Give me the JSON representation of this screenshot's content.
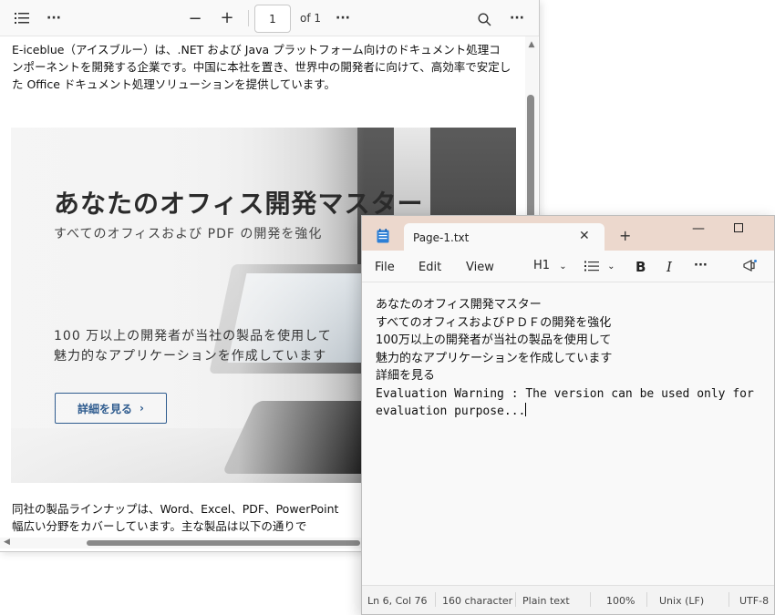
{
  "pdf_viewer": {
    "toolbar": {
      "page_number": "1",
      "page_total": "of 1"
    },
    "intro_text": "E-iceblue（アイスブルー）は、.NET および Java プラットフォーム向けのドキュメント処理コンポーネントを開発する企業です。中国に本社を置き、世界中の開発者に向けて、高効率で安定した Office ドキュメント処理ソリューションを提供しています。",
    "banner": {
      "title": "あなたのオフィス開発マスター",
      "subtitle": "すべてのオフィスおよび PDF の開発を強化",
      "body_line1": "100 万以上の開発者が当社の製品を使用して",
      "body_line2": "魅力的なアプリケーションを作成しています",
      "button": "詳細を見る"
    },
    "footer_line1": "同社の製品ラインナップは、Word、Excel、PDF、PowerPoint",
    "footer_line2": "幅広い分野をカバーしています。主な製品は以下の通りで"
  },
  "notepad": {
    "tab_title": "Page-1.txt",
    "menu": {
      "file": "File",
      "edit": "Edit",
      "view": "View"
    },
    "toolbar": {
      "heading": "H1",
      "bold": "B",
      "italic": "I"
    },
    "lines": [
      "あなたのオフィス開発マスター",
      "すべてのオフィスおよびＰＤＦの開発を強化",
      "100万以上の開発者が当社の製品を使用して",
      "魅力的なアプリケーションを作成しています",
      "詳細を見る",
      "Evaluation Warning : The version can be used only for",
      "evaluation purpose..."
    ],
    "status": {
      "position": "Ln 6, Col 76",
      "characters": "160 character",
      "format": "Plain text",
      "zoom": "100%",
      "line_ending": "Unix (LF)",
      "encoding": "UTF-8"
    }
  }
}
